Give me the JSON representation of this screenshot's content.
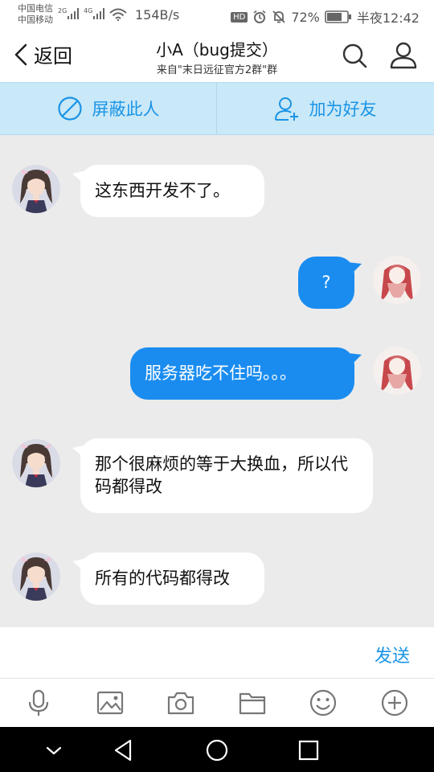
{
  "status_bar": {
    "carrier_1": "中国电信",
    "carrier_2": "中国移动",
    "sig1_type": "2G",
    "sig2_type": "4G",
    "speed": "154B/s",
    "hd": "HD",
    "battery": "72%",
    "time": "半夜12:42"
  },
  "header": {
    "back_label": "返回",
    "title": "小A（bug提交）",
    "subtitle": "来自\"末日远征官方2群\"群"
  },
  "actions": {
    "block_label": "屏蔽此人",
    "add_friend_label": "加为好友"
  },
  "messages": [
    {
      "side": "in",
      "text": "这东西开发不了。"
    },
    {
      "side": "out",
      "text": "?"
    },
    {
      "side": "out",
      "text": "服务器吃不住吗。。。"
    },
    {
      "side": "in",
      "text": "那个很麻烦的等于大换血，所以代码都得改"
    },
    {
      "side": "in",
      "text": "所有的代码都得改"
    }
  ],
  "composer": {
    "send_label": "发送"
  },
  "toolbar": {
    "icons": [
      "microphone-icon",
      "image-icon",
      "camera-icon",
      "folder-icon",
      "emoji-icon",
      "plus-icon"
    ]
  },
  "colors": {
    "accent": "#1a94e6",
    "outgoing_bubble": "#1a8cf0",
    "action_bar": "#c9e8f8",
    "chat_bg": "#ebebeb"
  }
}
